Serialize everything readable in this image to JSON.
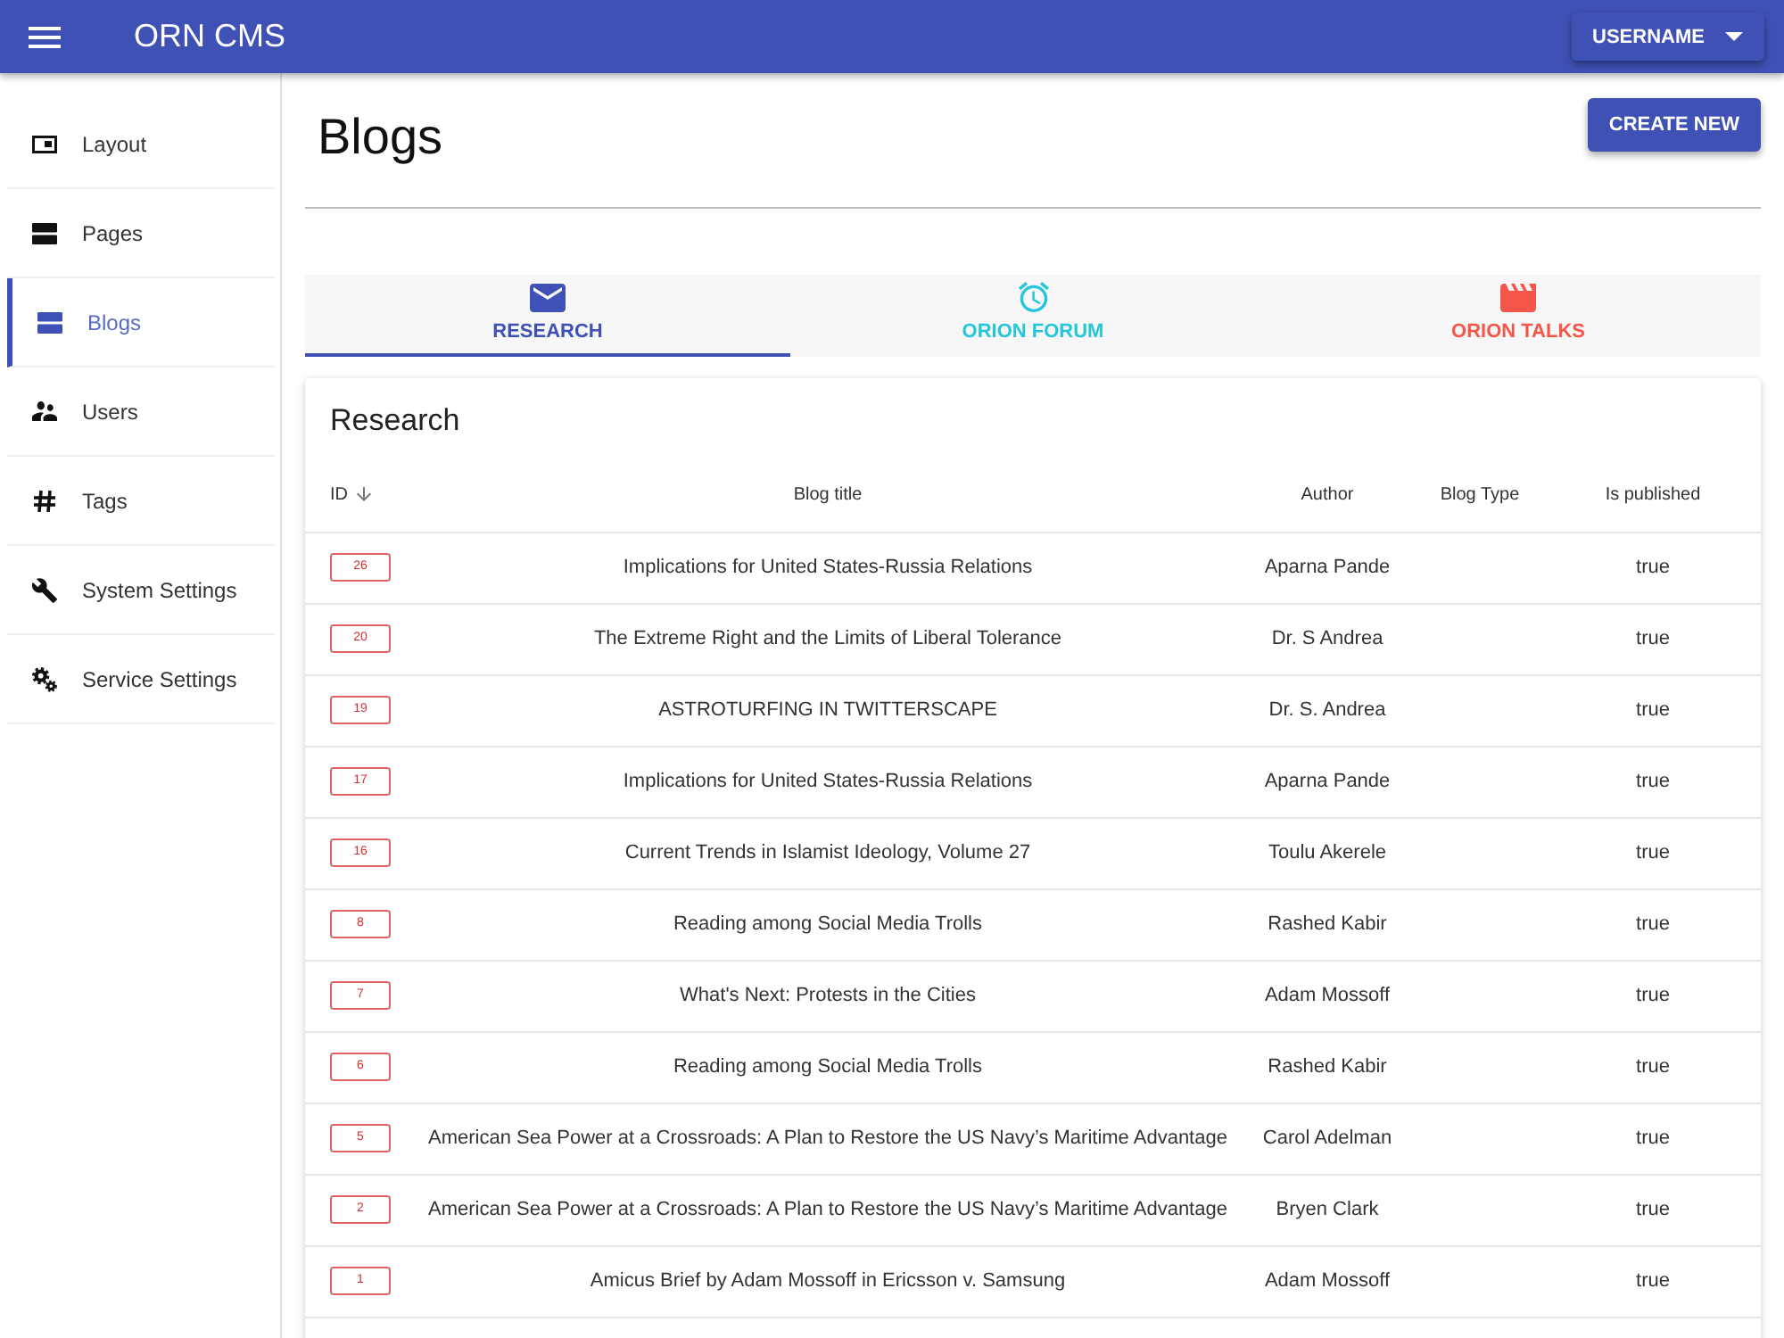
{
  "app_bar": {
    "title": "ORN CMS",
    "user_button": "USERNAME"
  },
  "sidebar": {
    "items": [
      {
        "label": "Layout",
        "selected": false
      },
      {
        "label": "Pages",
        "selected": false
      },
      {
        "label": "Blogs",
        "selected": true
      },
      {
        "label": "Users",
        "selected": false
      },
      {
        "label": "Tags",
        "selected": false
      },
      {
        "label": "System Settings",
        "selected": false
      },
      {
        "label": "Service Settings",
        "selected": false
      }
    ]
  },
  "page": {
    "title": "Blogs",
    "create_button": "CREATE NEW"
  },
  "tabs": [
    {
      "label": "RESEARCH",
      "selected": true,
      "color": "#3f51b5"
    },
    {
      "label": "ORION FORUM",
      "selected": false,
      "color": "#26c6da"
    },
    {
      "label": "ORION TALKS",
      "selected": false,
      "color": "#f4574a"
    }
  ],
  "table": {
    "title": "Research",
    "columns": [
      {
        "label": "ID",
        "sorted": true
      },
      {
        "label": "Blog title",
        "sorted": false
      },
      {
        "label": "Author",
        "sorted": false
      },
      {
        "label": "Blog Type",
        "sorted": false
      },
      {
        "label": "Is published",
        "sorted": false
      }
    ],
    "rows": [
      {
        "id": "26",
        "title": "Implications for United States-Russia Relations",
        "author": "Aparna Pande",
        "published": "true"
      },
      {
        "id": "20",
        "title": "The Extreme Right and the Limits of Liberal Tolerance",
        "author": "Dr. S Andrea",
        "published": "true"
      },
      {
        "id": "19",
        "title": "ASTROTURFING IN TWITTERSCAPE",
        "author": "Dr. S. Andrea",
        "published": "true"
      },
      {
        "id": "17",
        "title": "Implications for United States-Russia Relations",
        "author": "Aparna Pande",
        "published": "true"
      },
      {
        "id": "16",
        "title": "Current Trends in Islamist Ideology, Volume 27",
        "author": "Toulu Akerele",
        "published": "true"
      },
      {
        "id": "8",
        "title": "Reading among Social Media Trolls",
        "author": "Rashed Kabir",
        "published": "true"
      },
      {
        "id": "7",
        "title": "What's Next: Protests in the Cities",
        "author": "Adam Mossoff",
        "published": "true"
      },
      {
        "id": "6",
        "title": "Reading among Social Media Trolls",
        "author": "Rashed Kabir",
        "published": "true"
      },
      {
        "id": "5",
        "title": "American Sea Power at a Crossroads: A Plan to Restore the US Navy’s Maritime Advantage",
        "author": "Carol Adelman",
        "published": "true"
      },
      {
        "id": "2",
        "title": "American Sea Power at a Crossroads: A Plan to Restore the US Navy’s Maritime Advantage",
        "author": "Bryen Clark",
        "published": "true"
      },
      {
        "id": "1",
        "title": "Amicus Brief by Adam Mossoff in Ericsson v. Samsung",
        "author": "Adam Mossoff",
        "published": "true"
      }
    ]
  }
}
